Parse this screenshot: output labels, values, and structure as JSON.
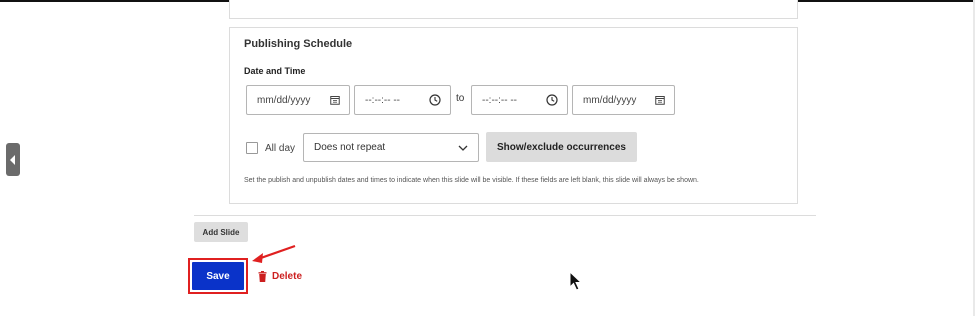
{
  "schedule": {
    "title": "Publishing Schedule",
    "date_time_label": "Date and Time",
    "start_date_placeholder": "mm/dd/yyyy",
    "start_time_placeholder": "--:--:-- --",
    "to_label": "to",
    "end_time_placeholder": "--:--:-- --",
    "end_date_placeholder": "mm/dd/yyyy",
    "all_day_label": "All day",
    "all_day_checked": false,
    "repeat_value": "Does not repeat",
    "occurrences_label": "Show/exclude occurrences",
    "help_text": "Set the publish and unpublish dates and times to indicate when this slide will be visible. If these fields are left blank, this slide will always be shown."
  },
  "actions": {
    "add_slide_label": "Add Slide",
    "save_label": "Save",
    "delete_label": "Delete"
  },
  "icons": {
    "calendar": "calendar-icon",
    "clock": "clock-icon",
    "chevron": "chevron-down-icon",
    "trash": "trash-icon",
    "side_toggle": "chevron-left-icon"
  },
  "colors": {
    "save_bg": "#0a33c9",
    "delete": "#cc1f1f",
    "highlight": "#e02020",
    "button_gray": "#dcdcdc"
  }
}
